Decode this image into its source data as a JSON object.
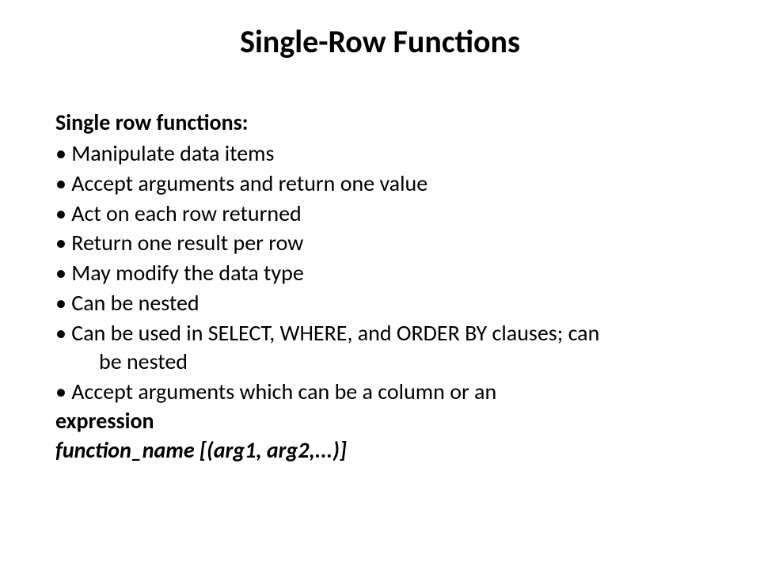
{
  "title": "Single-Row Functions",
  "subheading": "Single row functions:",
  "bullets": {
    "b1": "• Manipulate data items",
    "b2": "• Accept arguments and return one value",
    "b3": "• Act on each row returned",
    "b4": "• Return one result per row",
    "b5": "• May modify the data type",
    "b6": "• Can be nested",
    "b7a": "• Can be used in SELECT, WHERE, and ORDER BY clauses; can",
    "b7b": "be nested",
    "b8": "• Accept arguments which can be a column or an"
  },
  "expression_label": "expression",
  "syntax": "function_name [(arg1, arg2,...)]"
}
